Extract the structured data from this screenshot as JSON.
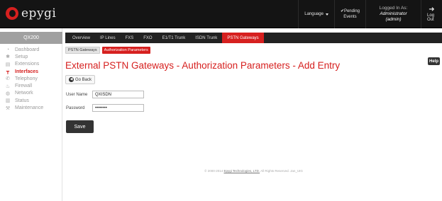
{
  "header": {
    "logo_text": "epygi",
    "language_label": "Language",
    "pending_label": "Pending",
    "pending_sub": "Events",
    "logged_label": "Logged In As:",
    "logged_user": "Administrator (admin)",
    "logout_label": "Log Out"
  },
  "sidebar": {
    "device": "QX200",
    "items": [
      {
        "label": "Dashboard",
        "icon": "dashboard-icon"
      },
      {
        "label": "Setup",
        "icon": "gear-icon"
      },
      {
        "label": "Extensions",
        "icon": "extensions-icon"
      },
      {
        "label": "Interfaces",
        "icon": "interfaces-icon",
        "active": true
      },
      {
        "label": "Telephony",
        "icon": "phone-icon"
      },
      {
        "label": "Firewall",
        "icon": "fire-icon"
      },
      {
        "label": "Network",
        "icon": "globe-icon"
      },
      {
        "label": "Status",
        "icon": "bar-chart-icon"
      },
      {
        "label": "Maintenance",
        "icon": "wrench-icon"
      }
    ]
  },
  "tabs": [
    "Overview",
    "IP Lines",
    "FXS",
    "FXO",
    "E1/T1 Trunk",
    "ISDN Trunk",
    "PSTN Gateways"
  ],
  "active_tab": "PSTN Gateways",
  "subtabs": {
    "first": "PSTN Gateways",
    "second": "Authorization Parameters"
  },
  "help_label": "Help",
  "page_title": "External PSTN Gateways - Authorization Parameters - Add Entry",
  "go_back_label": "Go Back",
  "form": {
    "username_label": "User Name",
    "username_value": "QXISDN",
    "password_label": "Password",
    "password_value": "••••••••"
  },
  "save_label": "Save",
  "footer": {
    "prefix": "© 2000-2014 ",
    "link": "Epygi Technologies, LTD.",
    "suffix": " All Rights Reserved. Jan_UIG"
  },
  "colors": {
    "accent": "#d6201f",
    "topbar": "#141414",
    "tabbar": "#222222"
  }
}
